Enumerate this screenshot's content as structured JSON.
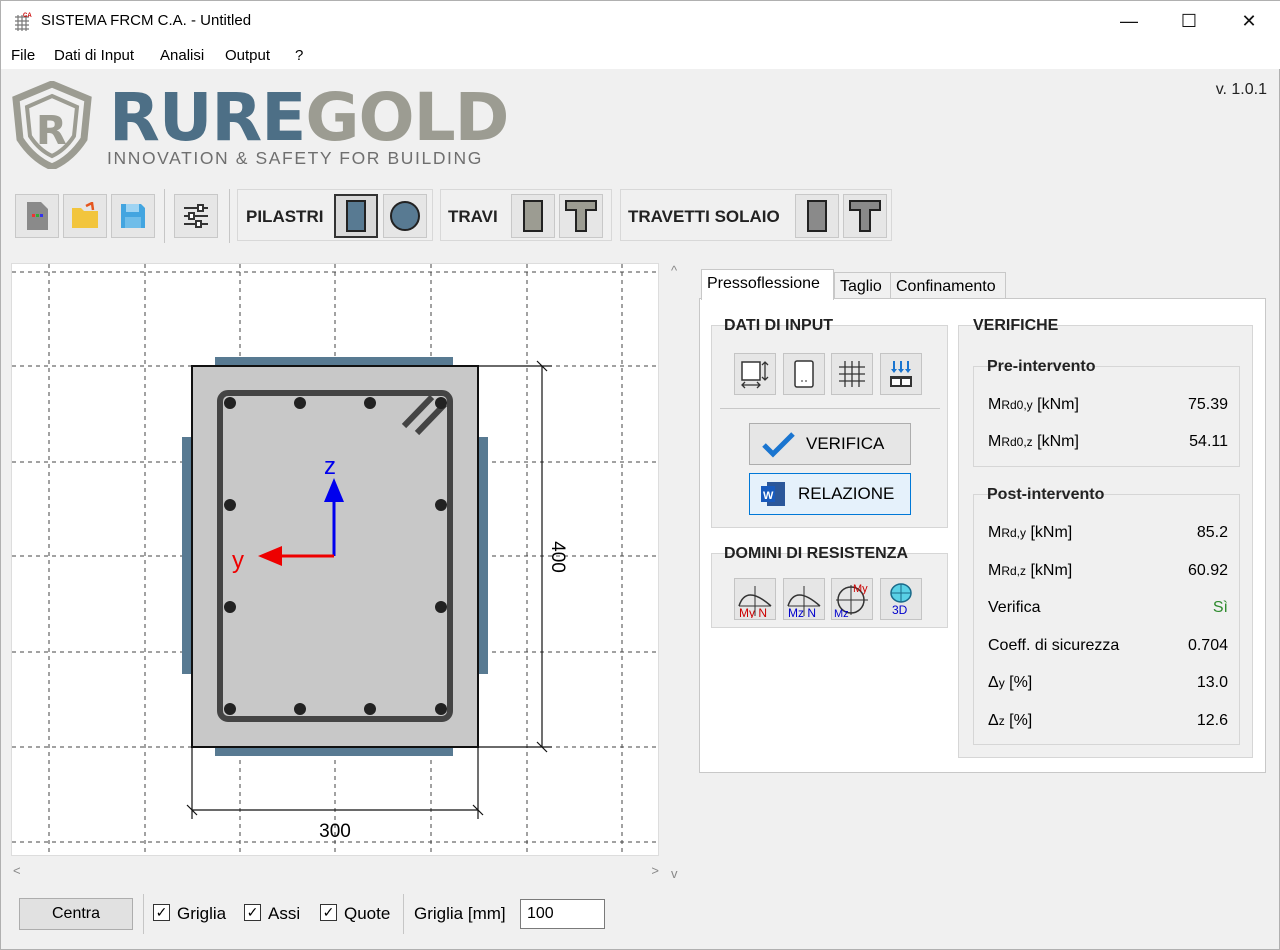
{
  "window": {
    "title": "SISTEMA FRCM C.A. - Untitled",
    "icon_badge": "CA",
    "minimize": "—",
    "maximize": "☐",
    "close": "✕"
  },
  "menu": [
    "File",
    "Dati di Input",
    "Analisi",
    "Output",
    "?"
  ],
  "header": {
    "version": "v. 1.0.1",
    "logo_part1": "RURE",
    "logo_part2": "GOLD",
    "tagline": "INNOVATION & SAFETY FOR BUILDING"
  },
  "toolbar": {
    "pilastri": "PILASTRI",
    "travi": "TRAVI",
    "travetti": "TRAVETTI SOLAIO"
  },
  "section": {
    "width_label": "300",
    "height_label": "400",
    "axis_y": "y",
    "axis_z": "z"
  },
  "tabs": {
    "pressoflessione": "Pressoflessione",
    "taglio": "Taglio",
    "confinamento": "Confinamento"
  },
  "input_group": {
    "title": "DATI DI INPUT",
    "verifica": "VERIFICA",
    "relazione": "RELAZIONE"
  },
  "domini": {
    "title": "DOMINI DI RESISTENZA",
    "icon1": "My N",
    "icon2": "Mz N",
    "icon3_top": "My",
    "icon3_bottom": "Mz",
    "icon4": "3D"
  },
  "verifiche": {
    "title": "VERIFICHE",
    "pre": {
      "title": "Pre-intervento",
      "rows": [
        {
          "main": "M",
          "sub": "Rd0,y",
          "unit": " [kNm]",
          "value": "75.39"
        },
        {
          "main": "M",
          "sub": "Rd0,z",
          "unit": " [kNm]",
          "value": "54.11"
        }
      ]
    },
    "post": {
      "title": "Post-intervento",
      "rows": [
        {
          "main": "M",
          "sub": "Rd,y",
          "unit": " [kNm]",
          "value": "85.2"
        },
        {
          "main": "M",
          "sub": "Rd,z",
          "unit": " [kNm]",
          "value": "60.92"
        },
        {
          "main": "Verifica",
          "sub": "",
          "unit": "",
          "value": "Sì"
        },
        {
          "main": "Coeff. di sicurezza",
          "sub": "",
          "unit": "",
          "value": "0.704"
        },
        {
          "main": "Δ",
          "sub": "y",
          "unit": " [%]",
          "value": "13.0"
        },
        {
          "main": "Δ",
          "sub": "z",
          "unit": " [%]",
          "value": "12.6"
        }
      ]
    },
    "ok_color": "#2e8b2e"
  },
  "bottom": {
    "centra": "Centra",
    "griglia_cb": "Griglia",
    "assi_cb": "Assi",
    "quote_cb": "Quote",
    "griglia_mm": "Griglia [mm]",
    "griglia_value": "100",
    "check": "✓"
  },
  "colors": {
    "brand_blue": "#4d6f86",
    "brand_grey": "#9c9c92",
    "frcm_strip": "#587a92",
    "concrete": "#c8c8c8",
    "axis_z": "#0000ee",
    "axis_y": "#ee0000"
  }
}
